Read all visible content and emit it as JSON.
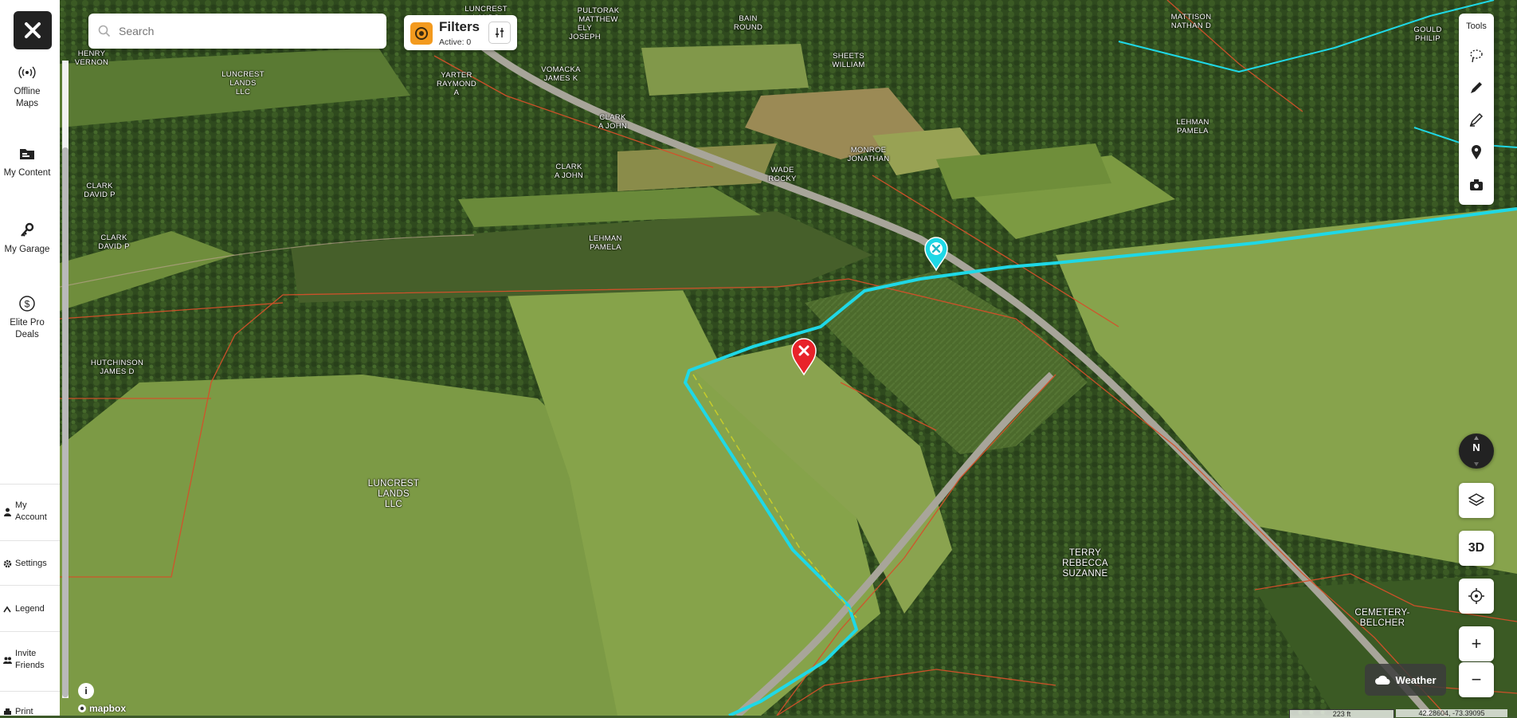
{
  "sidebar": {
    "items": [
      {
        "label": "Offline\nMaps",
        "icon": "offline-signal-icon"
      },
      {
        "label": "My Content",
        "icon": "folder-icon"
      },
      {
        "label": "My Garage",
        "icon": "key-icon"
      },
      {
        "label": "Elite Pro\nDeals",
        "icon": "dollar-icon"
      }
    ],
    "bottom_items": [
      {
        "label": "My\nAccount",
        "icon": "person-icon"
      },
      {
        "label": "Settings",
        "icon": "gear-icon"
      },
      {
        "label": "Legend",
        "icon": "legend-icon"
      },
      {
        "label": "Invite\nFriends",
        "icon": "people-icon"
      },
      {
        "label": "Print",
        "icon": "print-icon"
      }
    ]
  },
  "search": {
    "placeholder": "Search"
  },
  "filters": {
    "title": "Filters",
    "active": "Active: 0"
  },
  "tools": {
    "title": "Tools",
    "items": [
      "lasso-icon",
      "pencil-icon",
      "measure-icon",
      "pin-icon",
      "camera-icon"
    ]
  },
  "controls": {
    "compass": "N",
    "three_d": "3D",
    "zoom_in": "+",
    "zoom_out": "−",
    "weather": "Weather"
  },
  "attribution": {
    "mapbox": "mapbox",
    "info": "i"
  },
  "status": {
    "scale": "223 ft",
    "coordinates": "42.28604, -73.39095"
  },
  "parcels": [
    {
      "name": "LUNCREST\nLANDS\nLLC"
    },
    {
      "name": "HUTCHINSON\nJAMES D"
    },
    {
      "name": "CLARK\nDAVID P"
    },
    {
      "name": "CLARK\nDAVID P"
    },
    {
      "name": "LEHMAN\nPAMELA"
    },
    {
      "name": "WADE\nROCKY"
    },
    {
      "name": "MONROE\nJONATHAN"
    },
    {
      "name": "CLARK\nA JOHN"
    },
    {
      "name": "CLARK\nA JOHN"
    },
    {
      "name": "TERRY\nREBECCA\nSUZANNE"
    },
    {
      "name": "CEMETERY-\nBELCHER"
    },
    {
      "name": "LEHMAN\nPAMELA"
    },
    {
      "name": "SHEETS\nWILLIAM"
    },
    {
      "name": "LUNCREST\nLANDS\nLLC"
    },
    {
      "name": "YARTER\nRAYMOND\nA"
    },
    {
      "name": "VOMACKA\nJAMES K"
    },
    {
      "name": "HENRY\nVERNON"
    },
    {
      "name": "MATTISON\nNATHAN D"
    },
    {
      "name": "GOULD\nPHILIP"
    },
    {
      "name": "BAIN\nROUND"
    },
    {
      "name": "LUNCREST\nLANDS"
    },
    {
      "name": "ELY\nJOSEPH"
    },
    {
      "name": "PULTORAK\nMATTHEW"
    }
  ]
}
